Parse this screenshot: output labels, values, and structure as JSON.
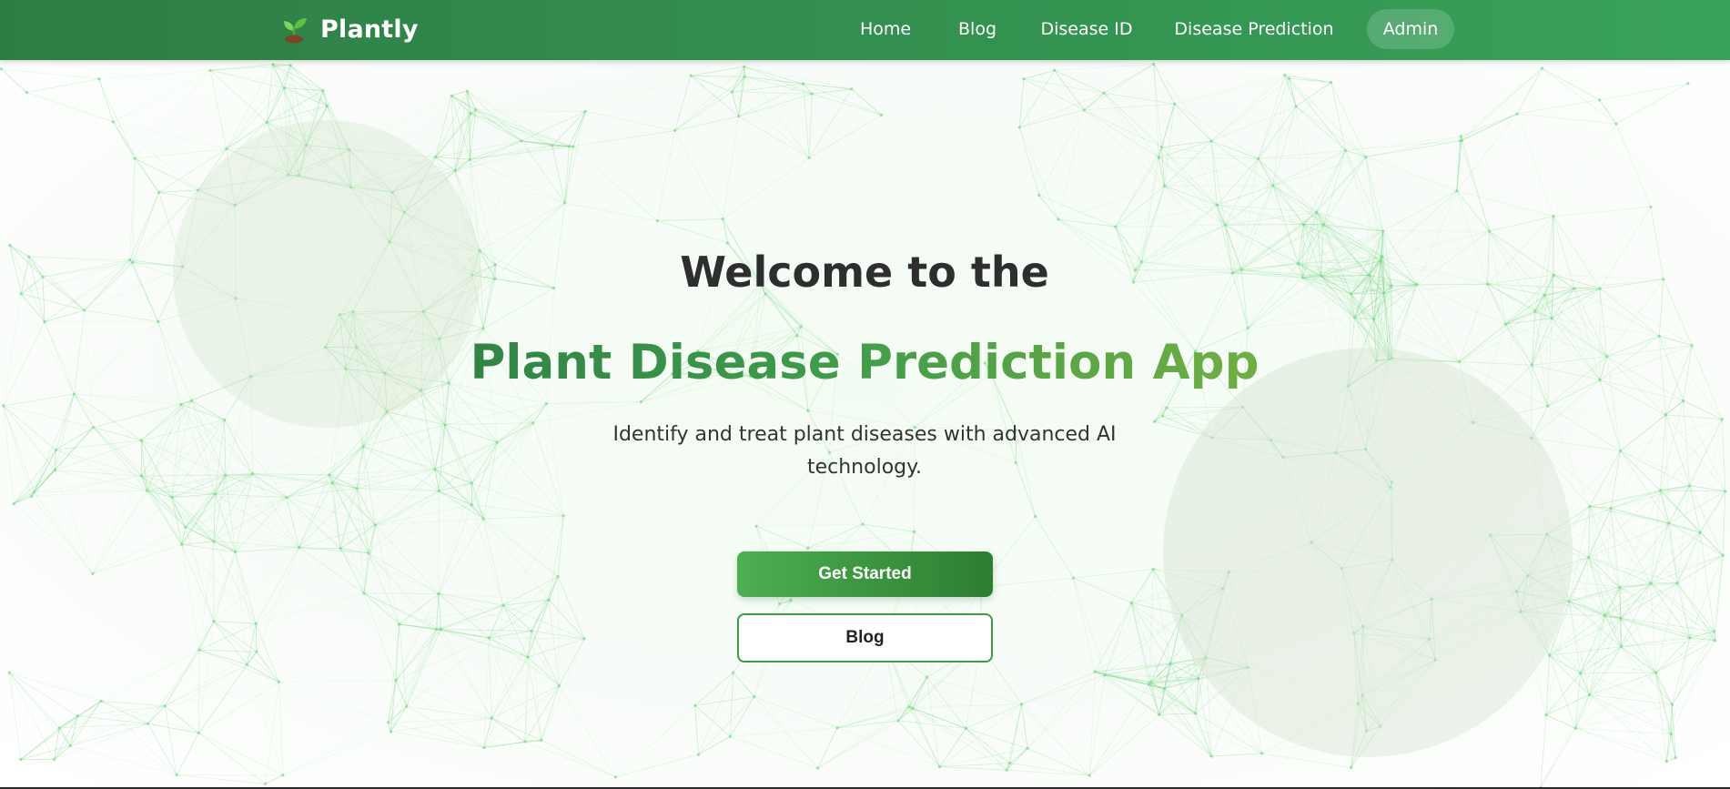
{
  "nav": {
    "brand": "Plantly",
    "items": [
      {
        "label": "Home"
      },
      {
        "label": "Blog"
      },
      {
        "label": "Disease ID"
      },
      {
        "label": "Disease Prediction"
      },
      {
        "label": "Admin",
        "active": true
      }
    ]
  },
  "hero": {
    "welcome": "Welcome to the",
    "title": "Plant Disease Prediction App",
    "subtitle": "Identify and treat plant diseases with advanced AI technology.",
    "primary_button": "Get Started",
    "secondary_button": "Blog"
  },
  "colors": {
    "nav_start": "#2e7d45",
    "nav_end": "#38a25a",
    "accent": "#4caf50",
    "network_line": "#7fd88a"
  },
  "icons": {
    "brand": "seedling-icon"
  }
}
